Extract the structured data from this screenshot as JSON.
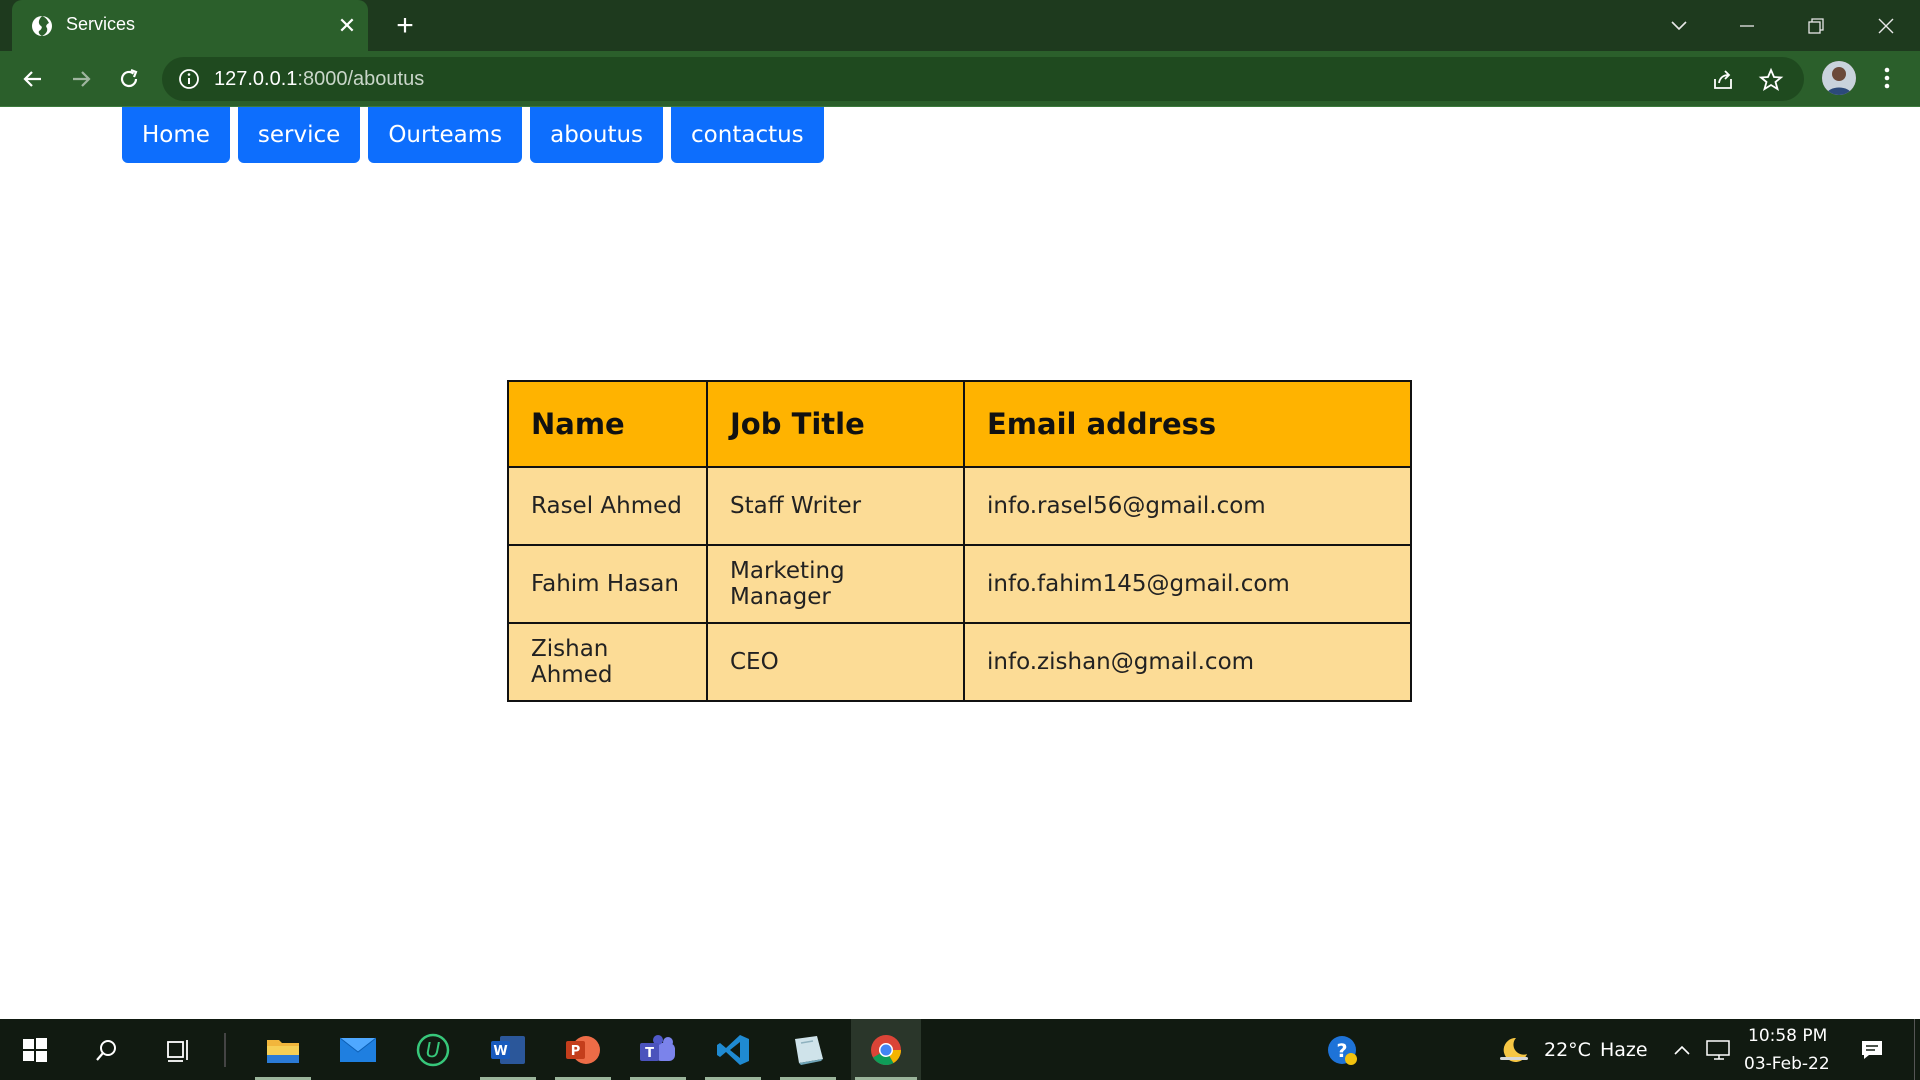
{
  "browser": {
    "tab_title": "Services",
    "url_host": "127.0.0.1",
    "url_rest": ":8000/aboutus"
  },
  "nav": {
    "items": [
      "Home",
      "service",
      "Ourteams",
      "aboutus",
      "contactus"
    ]
  },
  "table": {
    "headers": [
      "Name",
      "Job Title",
      "Email address"
    ],
    "rows": [
      [
        "Rasel Ahmed",
        "Staff Writer",
        "info.rasel56@gmail.com"
      ],
      [
        "Fahim Hasan",
        "Marketing Manager",
        "info.fahim145@gmail.com"
      ],
      [
        "Zishan Ahmed",
        "CEO",
        "info.zishan@gmail.com"
      ]
    ]
  },
  "colors": {
    "nav_button": "#0d6efd",
    "table_header": "#ffb300",
    "table_row": "#fcdc96",
    "browser_frame": "#2b5f2b"
  },
  "taskbar": {
    "apps": [
      "windows-start-icon",
      "search-icon",
      "task-view-icon",
      "file-explorer-icon",
      "mail-icon",
      "upwork-icon",
      "word-icon",
      "powerpoint-icon",
      "teams-icon",
      "vscode-icon",
      "notes-app-icon",
      "chrome-icon"
    ],
    "weather_temp": "22°C",
    "weather_desc": "Haze",
    "time": "10:58 PM",
    "date": "03-Feb-22"
  }
}
